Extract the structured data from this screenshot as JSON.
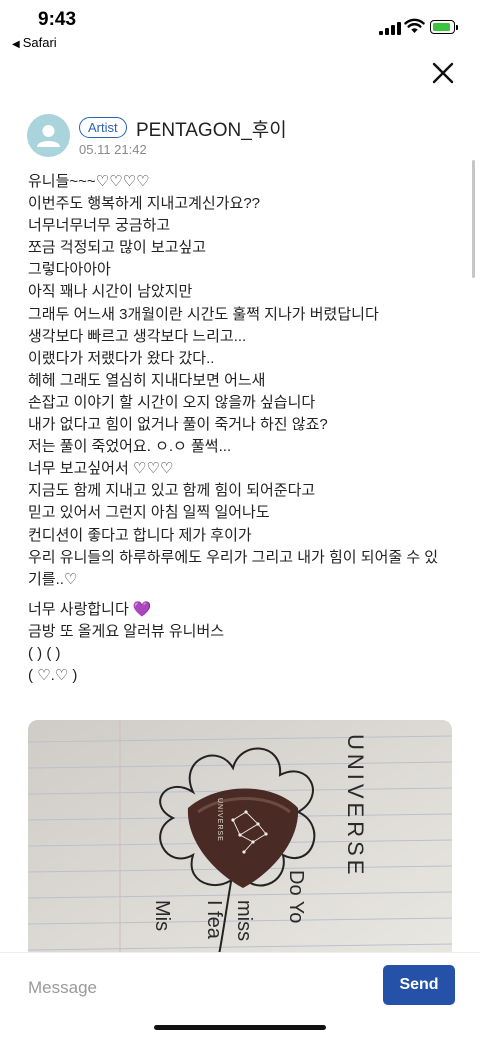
{
  "status": {
    "time": "9:43",
    "back_label": "Safari"
  },
  "author": {
    "badge": "Artist",
    "name": "PENTAGON_후이",
    "date": "05.11 21:42"
  },
  "post": {
    "lines_a": [
      "유니들~~~♡♡♡♡",
      "이번주도 행복하게 지내고계신가요??",
      "너무너무너무 궁금하고",
      "쪼금 걱정되고 많이 보고싶고",
      "그렇다아아아",
      "아직 꽤나 시간이 남았지만",
      "그래두 어느새 3개월이란 시간도 훌쩍 지나가 버렸답니다",
      "생각보다 빠르고 생각보다 느리고...",
      "이랬다가 저랬다가 왔다 갔다..",
      "헤헤  그래도 열심히 지내다보면 어느새",
      "손잡고 이야기 할 시간이 오지 않을까 싶습니다",
      "내가 없다고 힘이 없거나 풀이 죽거나 하진 않죠?",
      "저는 풀이 죽었어요. ㅇ.ㅇ 풀썩...",
      "너무 보고싶어서 ♡♡♡",
      "지금도 함께 지내고 있고 함께 힘이 되어준다고",
      "믿고 있어서 그런지 아침 일찍 일어나도",
      "컨디션이 좋다고 합니다 제가 후이가",
      "우리 유니들의 하루하루에도 우리가 그리고 내가 힘이 되어줄 수 있",
      "기를..♡"
    ],
    "lines_b": [
      "너무 사랑합니다 💜",
      "금방 또 올게요 알러뷰 유니버스",
      "   (  )   (  )",
      "(    ♡.♡  )"
    ]
  },
  "photo": {
    "word": [
      "U",
      "N",
      "I",
      "V",
      "E",
      "R",
      "S",
      "E"
    ],
    "pick_text": "UNIVERSE",
    "writing": [
      "Do Yo",
      "miss",
      "I fea",
      "Mis"
    ]
  },
  "composer": {
    "placeholder": "Message",
    "send_label": "Send"
  },
  "colors": {
    "accent": "#2552a8",
    "badge": "#2a63b5",
    "avatar": "#a9d4db"
  },
  "icons": {
    "close": "close-icon",
    "avatar": "person-icon"
  }
}
